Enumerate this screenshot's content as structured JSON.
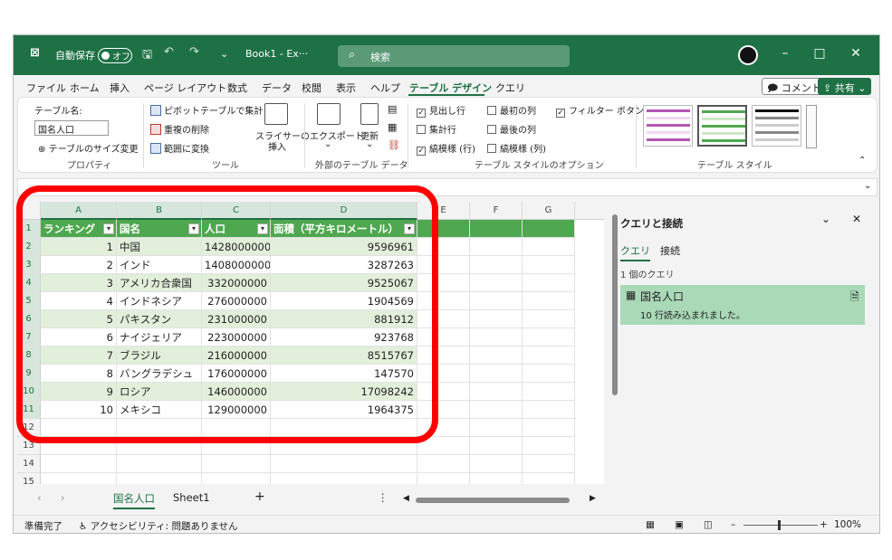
{
  "titlebar": {
    "autosave_label": "自動保存",
    "autosave_state": "オフ",
    "doc_title": "Book1 - Ex···",
    "search_placeholder": "検索",
    "minimize": "–",
    "maximize": "□",
    "close": "✕"
  },
  "menu": {
    "tabs": [
      "ファイル",
      "ホーム",
      "挿入",
      "ページ レイアウト",
      "数式",
      "データ",
      "校閲",
      "表示",
      "ヘルプ",
      "テーブル デザイン",
      "クエリ"
    ],
    "active_tab": "テーブル デザイン",
    "comment_button": "コメント",
    "share_button": "共有"
  },
  "ribbon": {
    "properties": {
      "table_name_label": "テーブル名:",
      "table_name_value": "国名人口",
      "resize_label": "テーブルのサイズ変更",
      "group_label": "プロパティ"
    },
    "tools": {
      "pivot": "ピボットテーブルで集計",
      "remove_duplicates": "重複の削除",
      "convert_range": "範囲に変換",
      "slicer": "スライサーの",
      "slicer2": "挿入",
      "group_label": "ツール"
    },
    "external": {
      "export": "エクスポート",
      "refresh": "更新",
      "group_label": "外部のテーブル データ"
    },
    "style_options": {
      "header_row": "見出し行",
      "total_row": "集計行",
      "banded_rows": "縞模様 (行)",
      "first_column": "最初の列",
      "last_column": "最後の列",
      "banded_columns": "縞模様 (列)",
      "filter_button": "フィルター ボタン",
      "group_label": "テーブル スタイルのオプション"
    },
    "table_styles_label": "テーブル スタイル"
  },
  "grid": {
    "columns": [
      "A",
      "B",
      "C",
      "D",
      "E",
      "F",
      "G"
    ],
    "rows": [
      "1",
      "2",
      "3",
      "4",
      "5",
      "6",
      "7",
      "8",
      "9",
      "10",
      "11",
      "12",
      "13",
      "14",
      "15"
    ],
    "headers": [
      "ランキング",
      "国名",
      "人口",
      "面積（平方キロメートル）"
    ],
    "data": [
      [
        "1",
        "中国",
        "1428000000",
        "9596961"
      ],
      [
        "2",
        "インド",
        "1408000000",
        "3287263"
      ],
      [
        "3",
        "アメリカ合衆国",
        "332000000",
        "9525067"
      ],
      [
        "4",
        "インドネシア",
        "276000000",
        "1904569"
      ],
      [
        "5",
        "パキスタン",
        "231000000",
        "881912"
      ],
      [
        "6",
        "ナイジェリア",
        "223000000",
        "923768"
      ],
      [
        "7",
        "ブラジル",
        "216000000",
        "8515767"
      ],
      [
        "8",
        "バングラデシュ",
        "176000000",
        "147570"
      ],
      [
        "9",
        "ロシア",
        "146000000",
        "17098242"
      ],
      [
        "10",
        "メキシコ",
        "129000000",
        "1964375"
      ]
    ]
  },
  "sheets": {
    "tabs": [
      "国名人口",
      "Sheet1"
    ],
    "active": "国名人口",
    "add": "+"
  },
  "query_pane": {
    "title": "クエリと接続",
    "tab_queries": "クエリ",
    "tab_connections": "接続",
    "count": "1 個のクエリ",
    "item_name": "国名人口",
    "item_status": "10 行読み込まれました。"
  },
  "status": {
    "ready": "準備完了",
    "accessibility": "アクセシビリティ: 問題ありません",
    "zoom": "100%"
  },
  "colors": {
    "excel_green": "#1e7145",
    "table_header": "#4fa84f",
    "band": "#e2efda",
    "highlight_red": "#ff0000"
  }
}
